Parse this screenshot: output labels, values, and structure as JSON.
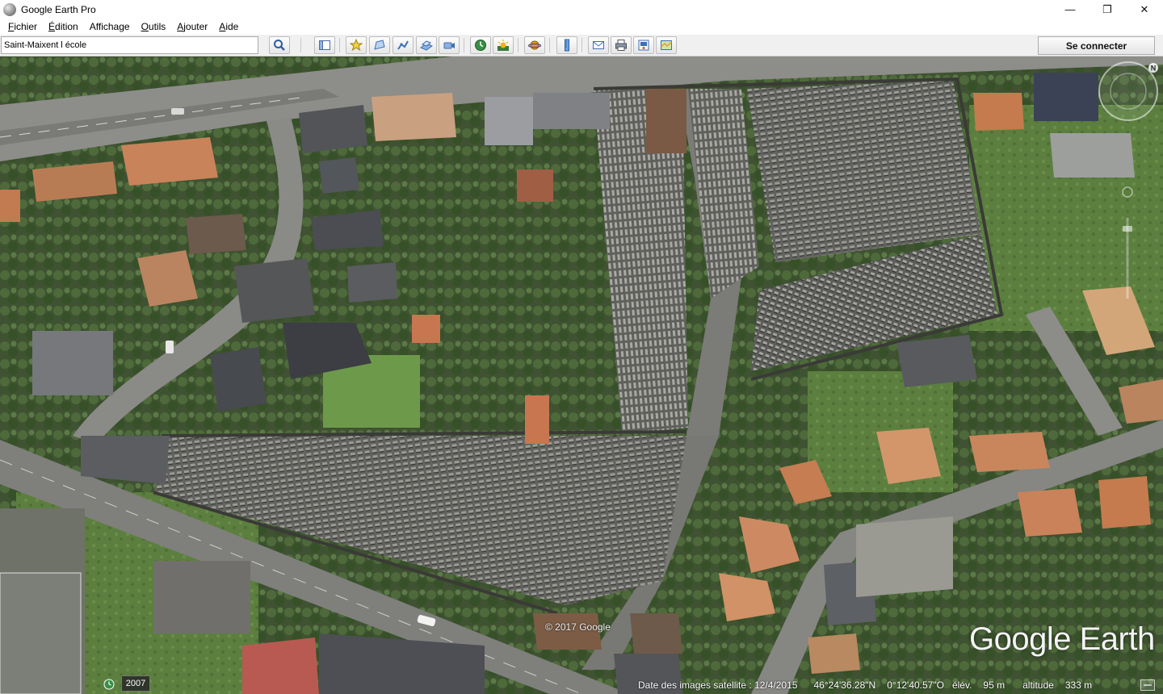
{
  "window": {
    "title": "Google Earth Pro",
    "minimize": "—",
    "maximize": "❐",
    "close": "✕"
  },
  "menu": [
    {
      "label": "Fichier",
      "mnemonic": "F",
      "rest": "ichier"
    },
    {
      "label": "Édition",
      "mnemonic": "É",
      "rest": "dition"
    },
    {
      "label": "Affichage",
      "mnemonic": "A",
      "rest": "ffichage"
    },
    {
      "label": "Outils",
      "mnemonic": "O",
      "rest": "utils"
    },
    {
      "label": "Ajouter",
      "mnemonic": "A",
      "rest": "jouter"
    },
    {
      "label": "Aide",
      "mnemonic": "A",
      "rest": "ide"
    }
  ],
  "search": {
    "value": "Saint-Maixent l école"
  },
  "toolbar": {
    "connect_label": "Se connecter",
    "icons": [
      "search-icon",
      "sidebar-toggle-icon",
      "add-placemark-icon",
      "add-polygon-icon",
      "add-path-icon",
      "add-image-overlay-icon",
      "record-tour-icon",
      "historical-imagery-icon",
      "sunlight-icon",
      "planets-icon",
      "ruler-icon",
      "email-icon",
      "print-icon",
      "save-image-icon",
      "view-in-maps-icon"
    ]
  },
  "map": {
    "copyright": "© 2017 Google",
    "brand": "Google Earth",
    "compass_label": "N",
    "imagery_year": "2007",
    "status": {
      "imagery_date": "Date des images satellite : 12/4/2015",
      "latitude": "46°24'36.28\"N",
      "longitude": "0°12'40.57\"O",
      "elevation_label": "élév.",
      "elevation_value": "95 m",
      "altitude_label": "altitude",
      "altitude_value": "333 m"
    }
  },
  "colors": {
    "toolbar_bg": "#f0f0f0",
    "map_green": "#4d5a3e",
    "road": "#8c8c8c",
    "roof_orange": "#c8835a",
    "cemetery_gray": "#6f706c"
  }
}
